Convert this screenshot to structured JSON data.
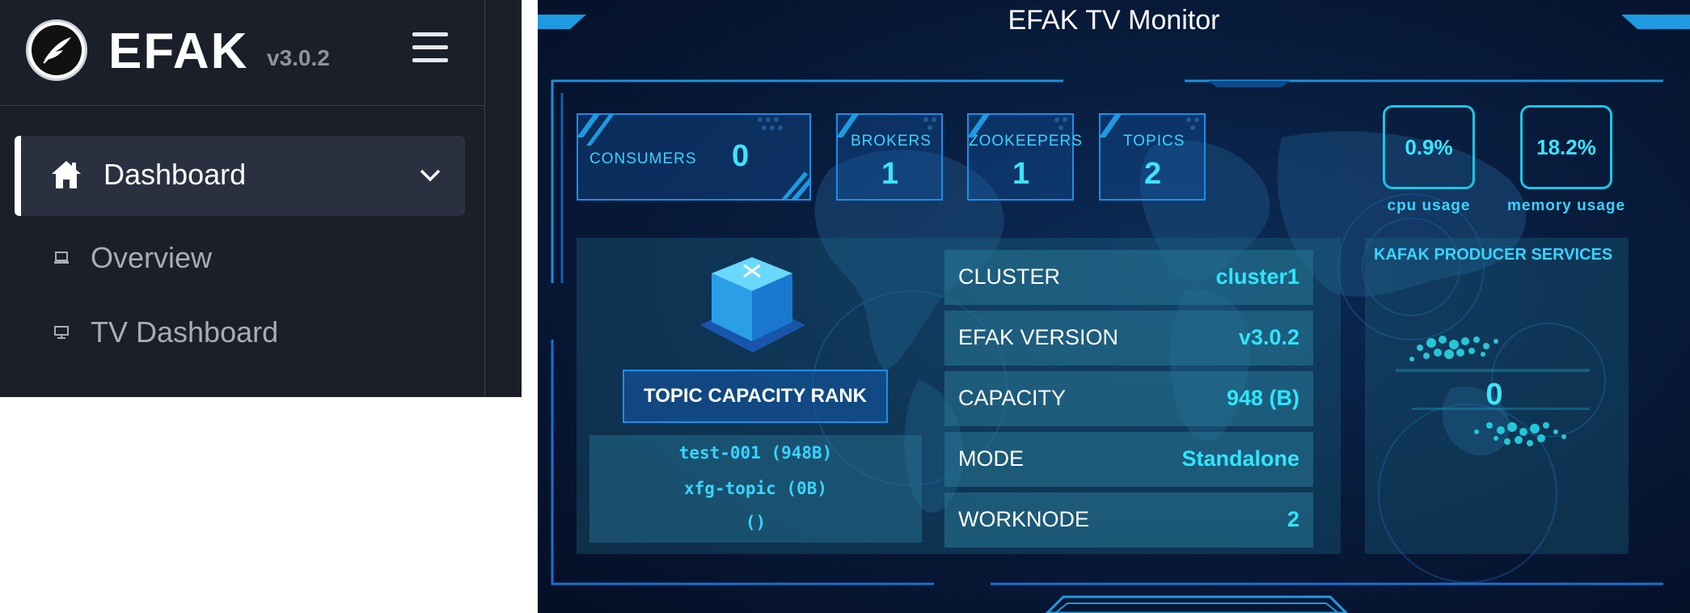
{
  "sidebar": {
    "brand": "EFAK",
    "version": "v3.0.2",
    "items": [
      {
        "label": "Dashboard",
        "icon": "home-icon",
        "expanded": true
      },
      {
        "label": "Overview",
        "icon": "laptop-icon"
      },
      {
        "label": "TV Dashboard",
        "icon": "monitor-icon"
      }
    ]
  },
  "tv": {
    "title": "EFAK  TV  Monitor",
    "stats": {
      "consumers": {
        "label": "CONSUMERS",
        "value": "0"
      },
      "brokers": {
        "label": "BROKERS",
        "value": "1"
      },
      "zookeepers": {
        "label": "ZOOKEEPERS",
        "value": "1"
      },
      "topics": {
        "label": "TOPICS",
        "value": "2"
      }
    },
    "cpu": {
      "value": "0.9%",
      "label": "cpu usage"
    },
    "memory": {
      "value": "18.2%",
      "label": "memory usage"
    },
    "rank": {
      "title": "TOPIC CAPACITY RANK",
      "items": [
        "test-001 (948B)",
        "xfg-topic (0B)",
        "()"
      ]
    },
    "info": [
      {
        "key": "CLUSTER",
        "value": "cluster1"
      },
      {
        "key": "EFAK VERSION",
        "value": "v3.0.2"
      },
      {
        "key": "CAPACITY",
        "value": "948 (B)"
      },
      {
        "key": "MODE",
        "value": "Standalone"
      },
      {
        "key": "WORKNODE",
        "value": "2"
      }
    ],
    "producer": {
      "title": "KAFAK PRODUCER SERVICES",
      "value": "0"
    },
    "colors": {
      "accent": "#3ee3ff",
      "frame": "#1a8fe8",
      "background": "#081c3d"
    }
  }
}
